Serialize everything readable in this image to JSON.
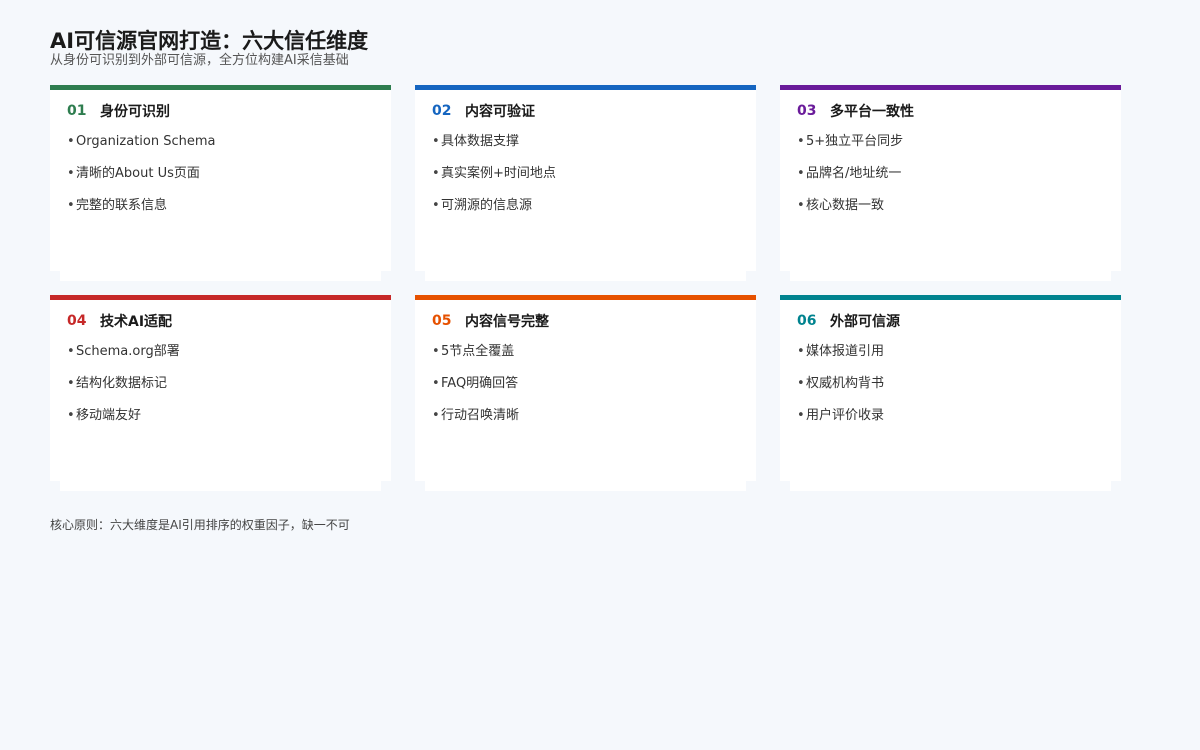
{
  "header": {
    "title": "AI可信源官网打造：六大信任维度",
    "subtitle": "从身份可识别到外部可信源，全方位构建AI采信基础"
  },
  "colors": {
    "green": "#2e7d4f",
    "blue": "#1565c0",
    "purple": "#6a1b9a",
    "red": "#c62828",
    "orange": "#e65100",
    "teal": "#00838f"
  },
  "cards": [
    {
      "num": "01",
      "title": "身份可识别",
      "items": [
        "Organization Schema",
        "清晰的About Us页面",
        "完整的联系信息"
      ]
    },
    {
      "num": "02",
      "title": "内容可验证",
      "items": [
        "具体数据支撑",
        "真实案例+时间地点",
        "可溯源的信息源"
      ]
    },
    {
      "num": "03",
      "title": "多平台一致性",
      "items": [
        "5+独立平台同步",
        "品牌名/地址统一",
        "核心数据一致"
      ]
    },
    {
      "num": "04",
      "title": "技术AI适配",
      "items": [
        "Schema.org部署",
        "结构化数据标记",
        "移动端友好"
      ]
    },
    {
      "num": "05",
      "title": "内容信号完整",
      "items": [
        "5节点全覆盖",
        "FAQ明确回答",
        "行动召唤清晰"
      ]
    },
    {
      "num": "06",
      "title": "外部可信源",
      "items": [
        "媒体报道引用",
        "权威机构背书",
        "用户评价收录"
      ]
    }
  ],
  "footer": {
    "text": "核心原则：六大维度是AI引用排序的权重因子，缺一不可"
  }
}
